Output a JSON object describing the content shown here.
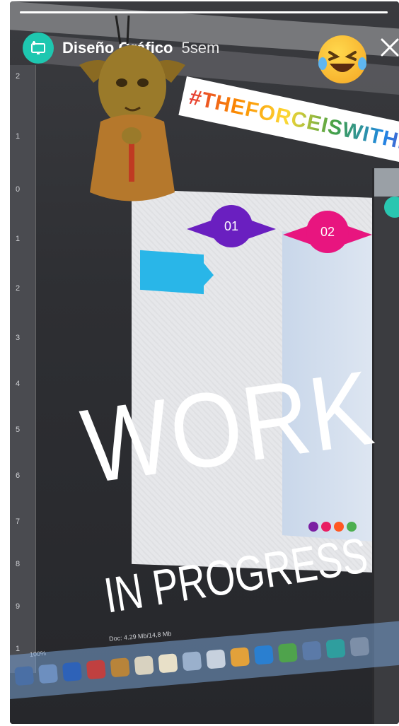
{
  "story": {
    "author": "Diseño Gráfico",
    "age": "5sem",
    "progress": 1.0
  },
  "icons": {
    "avatar": "design-monitor-icon",
    "close": "close-icon",
    "emoji": "laughing-emoji-icon"
  },
  "stickers": {
    "hashtag": "#THEFORCEISWITHME",
    "work_text": "WORK",
    "progress_text": "IN PROGRESS"
  },
  "artwork": {
    "badges": [
      "01",
      "02"
    ],
    "rulers": [
      "2",
      "1",
      "0",
      "1",
      "2",
      "3",
      "4",
      "5",
      "6",
      "7",
      "8",
      "9",
      "1"
    ]
  },
  "screen_status": {
    "zoom": "100%",
    "doc": "Doc: 4.29 Mb/14,8 Mb"
  },
  "colors": {
    "avatar": "#1ec7b0",
    "badge1": "#6a1fc0",
    "badge2": "#e8157f",
    "block": "#29b6e8",
    "dots": [
      "#7b1fa2",
      "#e91e63",
      "#ff5722",
      "#4caf50"
    ]
  }
}
